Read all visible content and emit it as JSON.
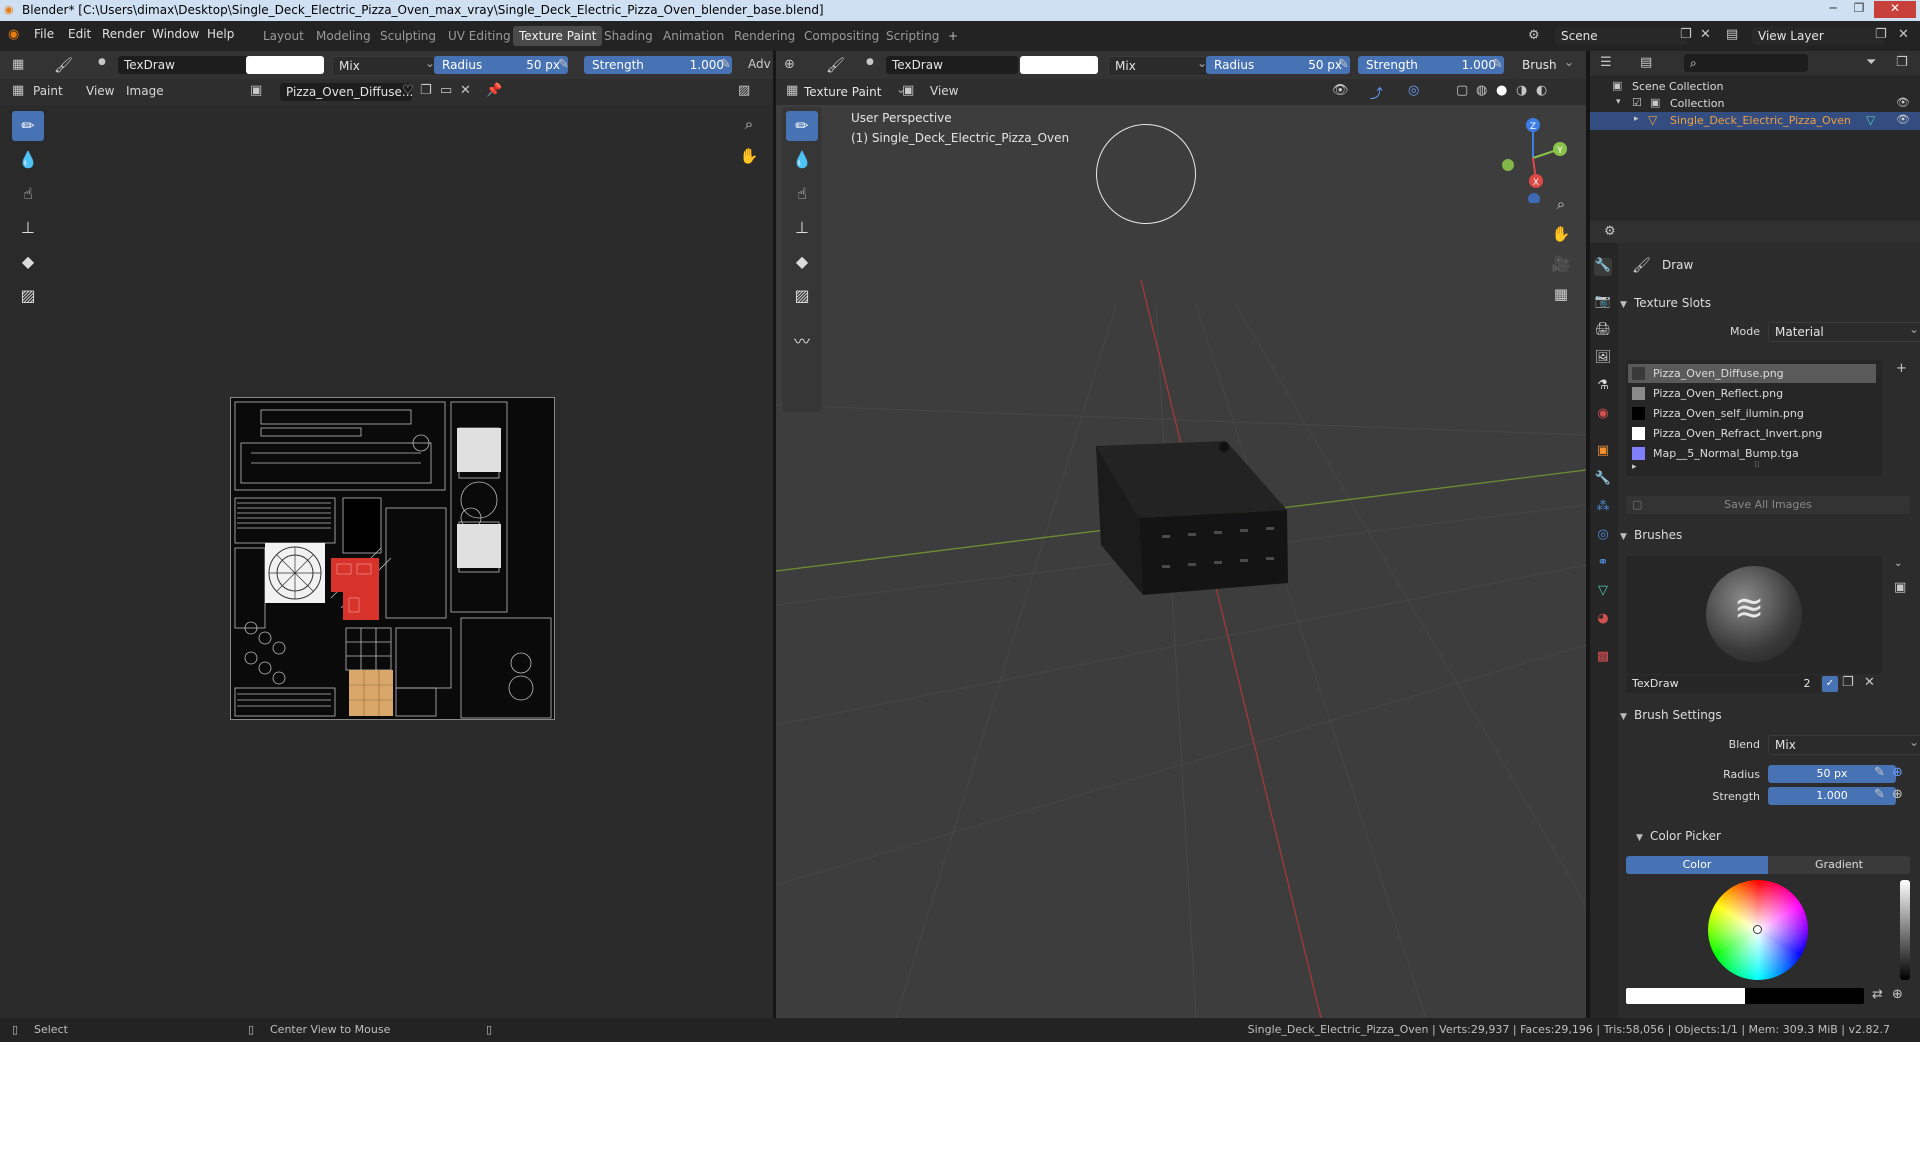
{
  "window": {
    "title": "Blender* [C:\\Users\\dimax\\Desktop\\Single_Deck_Electric_Pizza_Oven_max_vray\\Single_Deck_Electric_Pizza_Oven_blender_base.blend]",
    "controls": [
      "─",
      "❐",
      "✕"
    ]
  },
  "menu": [
    "File",
    "Edit",
    "Render",
    "Window",
    "Help"
  ],
  "workspaces": [
    "Layout",
    "Modeling",
    "Sculpting",
    "UV Editing",
    "Texture Paint",
    "Shading",
    "Animation",
    "Rendering",
    "Compositing",
    "Scripting",
    "+"
  ],
  "active_workspace": "Texture Paint",
  "scene": {
    "label": "Scene",
    "view_layer": "View Layer"
  },
  "image_editor": {
    "brush_name": "TexDraw",
    "blend": "Mix",
    "radius_label": "Radius",
    "radius_value": "50 px",
    "strength_label": "Strength",
    "strength_value": "1.000",
    "adv_label": "Adv",
    "mode": "Paint",
    "view_menu": "View",
    "image_menu": "Image",
    "image_name": "Pizza_Oven_Diffuse..."
  },
  "viewport": {
    "brush_name": "TexDraw",
    "blend": "Mix",
    "radius_label": "Radius",
    "radius_value": "50 px",
    "strength_label": "Strength",
    "strength_value": "1.000",
    "brush_menu": "Brush",
    "mode": "Texture Paint",
    "view_menu": "View",
    "overlay_title": "User Perspective",
    "overlay_object": "(1) Single_Deck_Electric_Pizza_Oven",
    "gizmo": {
      "x": "X",
      "y": "Y",
      "z": "Z"
    }
  },
  "outliner": {
    "root": "Scene Collection",
    "collection": "Collection",
    "object": "Single_Deck_Electric_Pizza_Oven"
  },
  "properties": {
    "tool_name": "Draw",
    "texture_slots": {
      "title": "Texture Slots",
      "mode_label": "Mode",
      "mode_value": "Material",
      "slots": [
        {
          "name": "Pizza_Oven_Diffuse.png",
          "swatch": "#3a3a3a"
        },
        {
          "name": "Pizza_Oven_Reflect.png",
          "swatch": "#8a8a8a"
        },
        {
          "name": "Pizza_Oven_self_ilumin.png",
          "swatch": "#000000"
        },
        {
          "name": "Pizza_Oven_Refract_Invert.png",
          "swatch": "#ffffff"
        },
        {
          "name": "Map__5_Normal_Bump.tga",
          "swatch": "#8080ff"
        }
      ],
      "save_all": "Save All Images"
    },
    "brushes": {
      "title": "Brushes",
      "name": "TexDraw",
      "users": "2"
    },
    "brush_settings": {
      "title": "Brush Settings",
      "blend_label": "Blend",
      "blend_value": "Mix",
      "radius_label": "Radius",
      "radius_value": "50 px",
      "strength_label": "Strength",
      "strength_value": "1.000"
    },
    "color_picker": {
      "title": "Color Picker",
      "tab_color": "Color",
      "tab_gradient": "Gradient"
    }
  },
  "status": {
    "select": "Select",
    "center": "Center View to Mouse",
    "info": "Single_Deck_Electric_Pizza_Oven | Verts:29,937 | Faces:29,196 | Tris:58,056 | Objects:1/1 | Mem: 309.3 MiB | v2.82.7"
  },
  "colors": {
    "accent": "#4772b3",
    "editor_bg": "#2b2b2b",
    "viewport_bg": "#3d3d3d",
    "selected_object": "#f0a040",
    "uv_red": "#d8332a",
    "uv_orange": "#d9a76a"
  }
}
